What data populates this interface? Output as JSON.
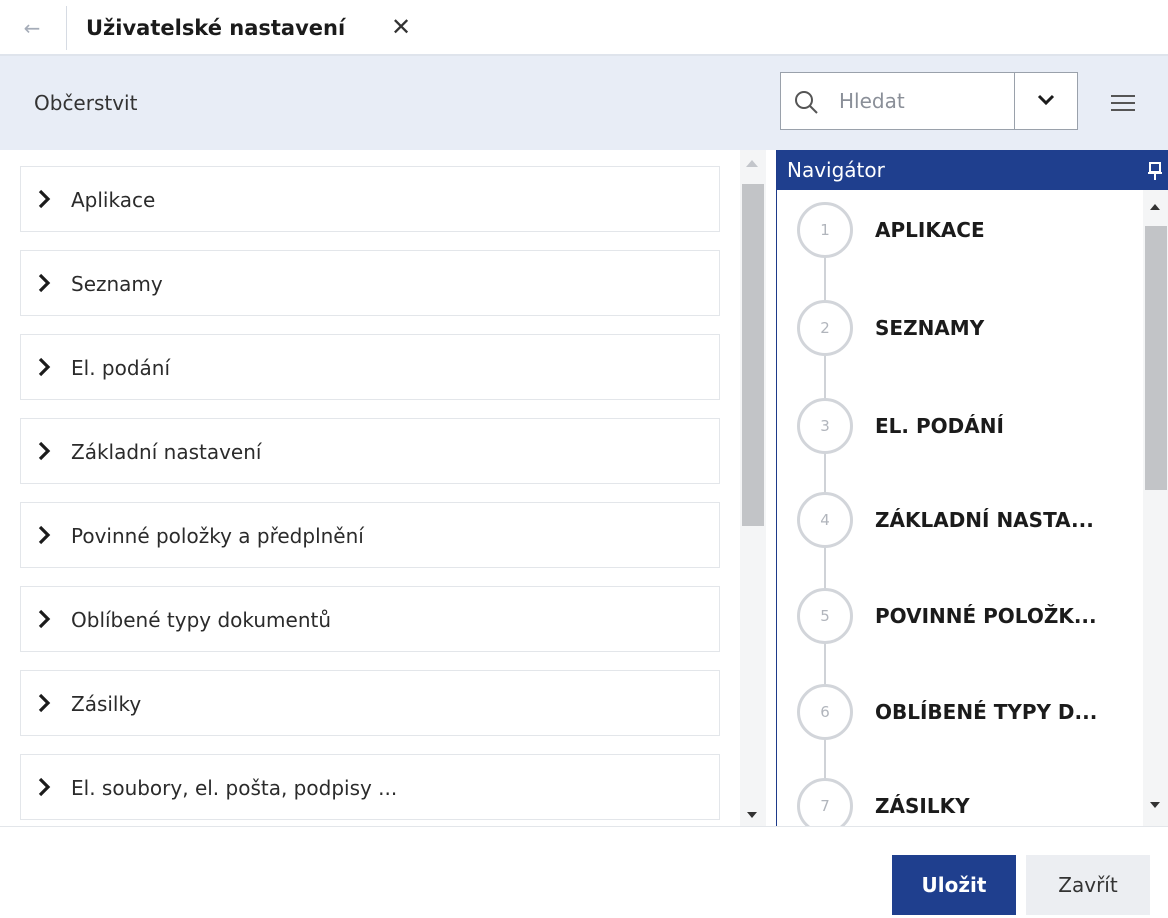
{
  "tab": {
    "back_icon": "arrow-left-icon",
    "title": "Uživatelské nastavení",
    "close_icon": "close-icon"
  },
  "toolbar": {
    "refresh_label": "Občerstvit",
    "search": {
      "placeholder": "Hledat",
      "value": "",
      "icon": "search-icon"
    },
    "dropdown_icon": "chevron-down-icon",
    "menu_icon": "hamburger-menu-icon"
  },
  "list": {
    "items": [
      {
        "label": "Aplikace"
      },
      {
        "label": "Seznamy"
      },
      {
        "label": "El. podání"
      },
      {
        "label": "Základní nastavení"
      },
      {
        "label": "Povinné položky a předplnění"
      },
      {
        "label": "Oblíbené typy dokumentů"
      },
      {
        "label": "Zásilky"
      },
      {
        "label": "El. soubory, el. pošta, podpisy ..."
      }
    ]
  },
  "navigator": {
    "title": "Navigátor",
    "pin_icon": "pin-icon",
    "steps": [
      {
        "num": "1",
        "label": "APLIKACE"
      },
      {
        "num": "2",
        "label": "SEZNAMY"
      },
      {
        "num": "3",
        "label": "EL. PODÁNÍ"
      },
      {
        "num": "4",
        "label": "ZÁKLADNÍ NASTA..."
      },
      {
        "num": "5",
        "label": "POVINNÉ POLOŽK..."
      },
      {
        "num": "6",
        "label": "OBLÍBENÉ TYPY D..."
      },
      {
        "num": "7",
        "label": "ZÁSILKY"
      }
    ]
  },
  "footer": {
    "save_label": "Uložit",
    "close_label": "Zavřít"
  },
  "colors": {
    "accent": "#1f3f8e",
    "toolbar_bg": "#e8edf6"
  }
}
